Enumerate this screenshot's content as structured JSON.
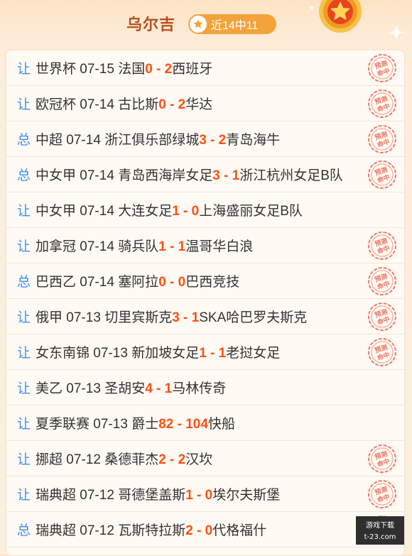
{
  "header": {
    "expert_name": "乌尔吉",
    "record_badge": "近14中11"
  },
  "stamp_text": "预测命中",
  "colors": {
    "accent_orange": "#f4a33a",
    "score_red": "#ff4f0f",
    "type_blue": "#3f8ff0",
    "title_brown": "#b6501f",
    "stamp_red": "#e8533d"
  },
  "matches": [
    {
      "type": "让",
      "league": "世界杯",
      "date": "07-15",
      "home": "法国",
      "home_score": "0",
      "sep": " - ",
      "away_score": "2",
      "away": "西班牙",
      "hit": true
    },
    {
      "type": "让",
      "league": "欧冠杯",
      "date": "07-14",
      "home": "古比斯",
      "home_score": "0",
      "sep": " - ",
      "away_score": "2",
      "away": "华达",
      "hit": true
    },
    {
      "type": "总",
      "league": "中超",
      "date": "07-14",
      "home": "浙江俱乐部绿城",
      "home_score": "3",
      "sep": " - ",
      "away_score": "2",
      "away": "青岛海牛",
      "hit": true
    },
    {
      "type": "总",
      "league": "中女甲",
      "date": "07-14",
      "home": "青岛西海岸女足",
      "home_score": "3",
      "sep": " - ",
      "away_score": "1",
      "away": "浙江杭州女足B队",
      "hit": true
    },
    {
      "type": "让",
      "league": "中女甲",
      "date": "07-14",
      "home": "大连女足",
      "home_score": "1",
      "sep": " - ",
      "away_score": "0",
      "away": "上海盛丽女足B队",
      "hit": false
    },
    {
      "type": "让",
      "league": "加拿冠",
      "date": "07-14",
      "home": "骑兵队",
      "home_score": "1",
      "sep": " - ",
      "away_score": "1",
      "away": "温哥华白浪",
      "hit": true
    },
    {
      "type": "总",
      "league": "巴西乙",
      "date": "07-14",
      "home": "塞阿拉",
      "home_score": "0",
      "sep": " - ",
      "away_score": "0",
      "away": "巴西竞技",
      "hit": true
    },
    {
      "type": "让",
      "league": "俄甲",
      "date": "07-13",
      "home": "切里宾斯克",
      "home_score": "3",
      "sep": " - ",
      "away_score": "1",
      "away": "SKA哈巴罗夫斯克",
      "hit": true
    },
    {
      "type": "让",
      "league": "女东南锦",
      "date": "07-13",
      "home": "新加坡女足",
      "home_score": "1",
      "sep": " - ",
      "away_score": "1",
      "away": "老挝女足",
      "hit": true
    },
    {
      "type": "让",
      "league": "美乙",
      "date": "07-13",
      "home": "圣胡安",
      "home_score": "4",
      "sep": " - ",
      "away_score": "1",
      "away": "马林传奇",
      "hit": false
    },
    {
      "type": "让",
      "league": "夏季联赛",
      "date": "07-13",
      "home": "爵士",
      "home_score": "82",
      "sep": " - ",
      "away_score": "104",
      "away": "快船",
      "hit": false
    },
    {
      "type": "让",
      "league": "挪超",
      "date": "07-12",
      "home": "桑德菲杰",
      "home_score": "2",
      "sep": " - ",
      "away_score": "2",
      "away": "汉坎",
      "hit": true
    },
    {
      "type": "让",
      "league": "瑞典超",
      "date": "07-12",
      "home": "哥德堡盖斯",
      "home_score": "1",
      "sep": " - ",
      "away_score": "0",
      "away": "埃尔夫斯堡",
      "hit": true
    },
    {
      "type": "总",
      "league": "瑞典超",
      "date": "07-12",
      "home": "瓦斯特拉斯",
      "home_score": "2",
      "sep": " - ",
      "away_score": "0",
      "away": "代格福什",
      "hit": true
    }
  ],
  "watermark": {
    "line1": "游戏下载",
    "line2": "t-23.com"
  }
}
